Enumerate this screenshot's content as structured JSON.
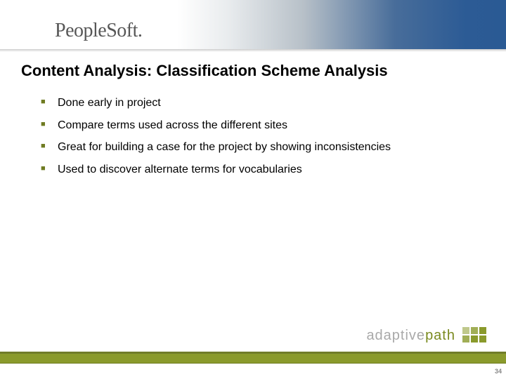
{
  "header": {
    "logo_text_1": "People",
    "logo_text_2": "Soft",
    "logo_dot": "."
  },
  "title": "Content Analysis: Classification Scheme Analysis",
  "bullets": [
    "Done early in project",
    "Compare terms used across the different sites",
    "Great for building a case for the project by showing inconsistencies",
    "Used to discover alternate terms for vocabularies"
  ],
  "footer": {
    "brand_1": "adaptive",
    "brand_2": "path",
    "page_number": "34"
  }
}
